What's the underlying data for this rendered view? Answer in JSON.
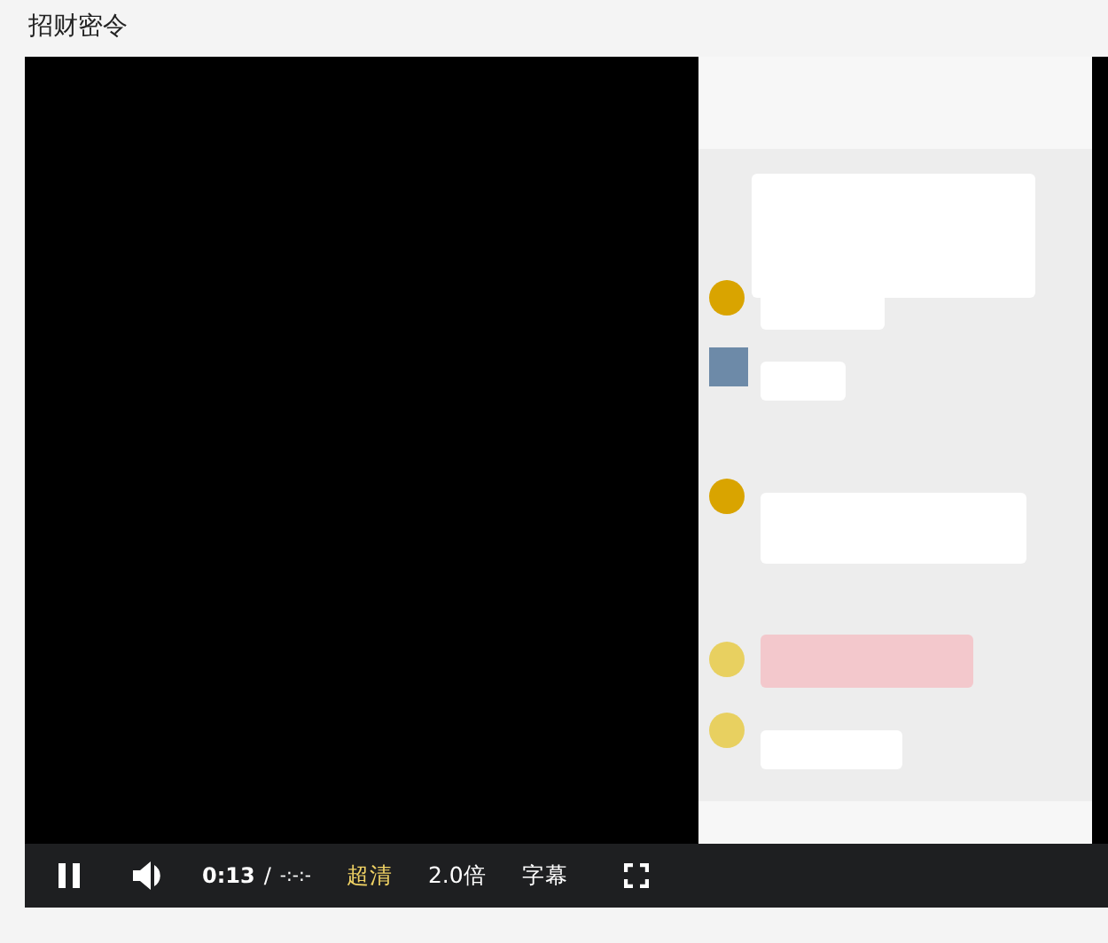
{
  "page": {
    "title": "招财密令"
  },
  "player": {
    "playing": true,
    "time": "0:13",
    "separator": "/",
    "duration": "-:-:-",
    "controls": [
      {
        "label": "超清",
        "selected": true
      },
      {
        "label": "2.0倍",
        "selected": false
      },
      {
        "label": "字幕",
        "selected": false
      }
    ]
  }
}
